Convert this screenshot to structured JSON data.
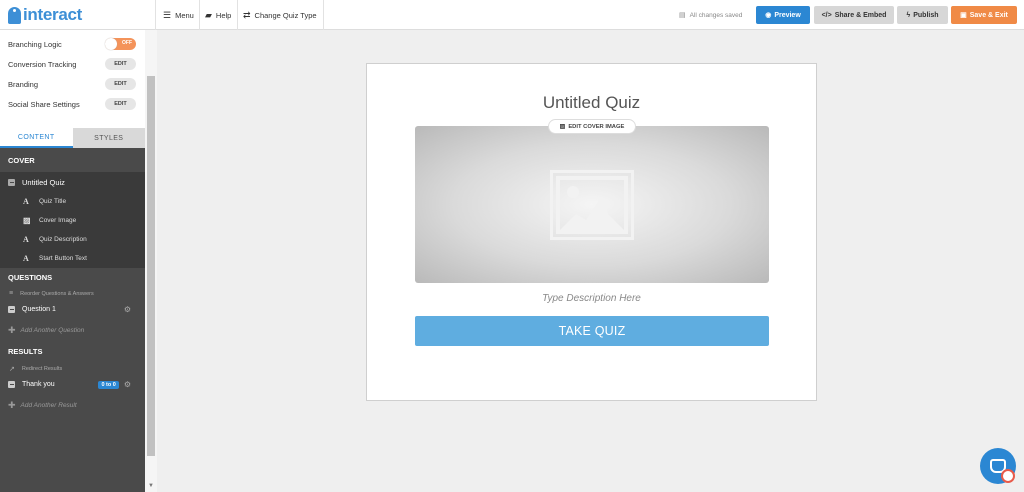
{
  "app": {
    "logo_text": "interact"
  },
  "toolbar": {
    "menu_label": "Menu",
    "help_label": "Help",
    "change_type_label": "Change Quiz Type",
    "status_text": "All changes saved",
    "preview_label": "Preview",
    "share_label": "Share & Embed",
    "publish_label": "Publish",
    "save_exit_label": "Save & Exit"
  },
  "settings": {
    "branching_label": "Branching Logic",
    "branching_toggle": "OFF",
    "conversion_label": "Conversion Tracking",
    "branding_label": "Branding",
    "social_label": "Social Share Settings",
    "edit_label": "EDIT"
  },
  "tabs": {
    "content": "CONTENT",
    "styles": "STYLES"
  },
  "cover": {
    "section_title": "COVER",
    "item_title": "Untitled Quiz",
    "sub_items": [
      "Quiz Title",
      "Cover Image",
      "Quiz Description",
      "Start Button Text"
    ]
  },
  "questions": {
    "section_title": "QUESTIONS",
    "reorder_label": "Reorder Questions & Answers",
    "item_label": "Question 1",
    "add_label": "Add Another Question"
  },
  "results": {
    "section_title": "RESULTS",
    "redirect_label": "Redirect Results",
    "item_label": "Thank you",
    "item_badge": "0 to 0",
    "add_label": "Add Another Result"
  },
  "canvas": {
    "quiz_title": "Untitled Quiz",
    "edit_cover_label": "EDIT COVER IMAGE",
    "description_placeholder": "Type Description Here",
    "start_button": "TAKE QUIZ"
  },
  "colors": {
    "accent": "#2b87d3",
    "save": "#f08a46",
    "take_quiz": "#5fade0"
  }
}
